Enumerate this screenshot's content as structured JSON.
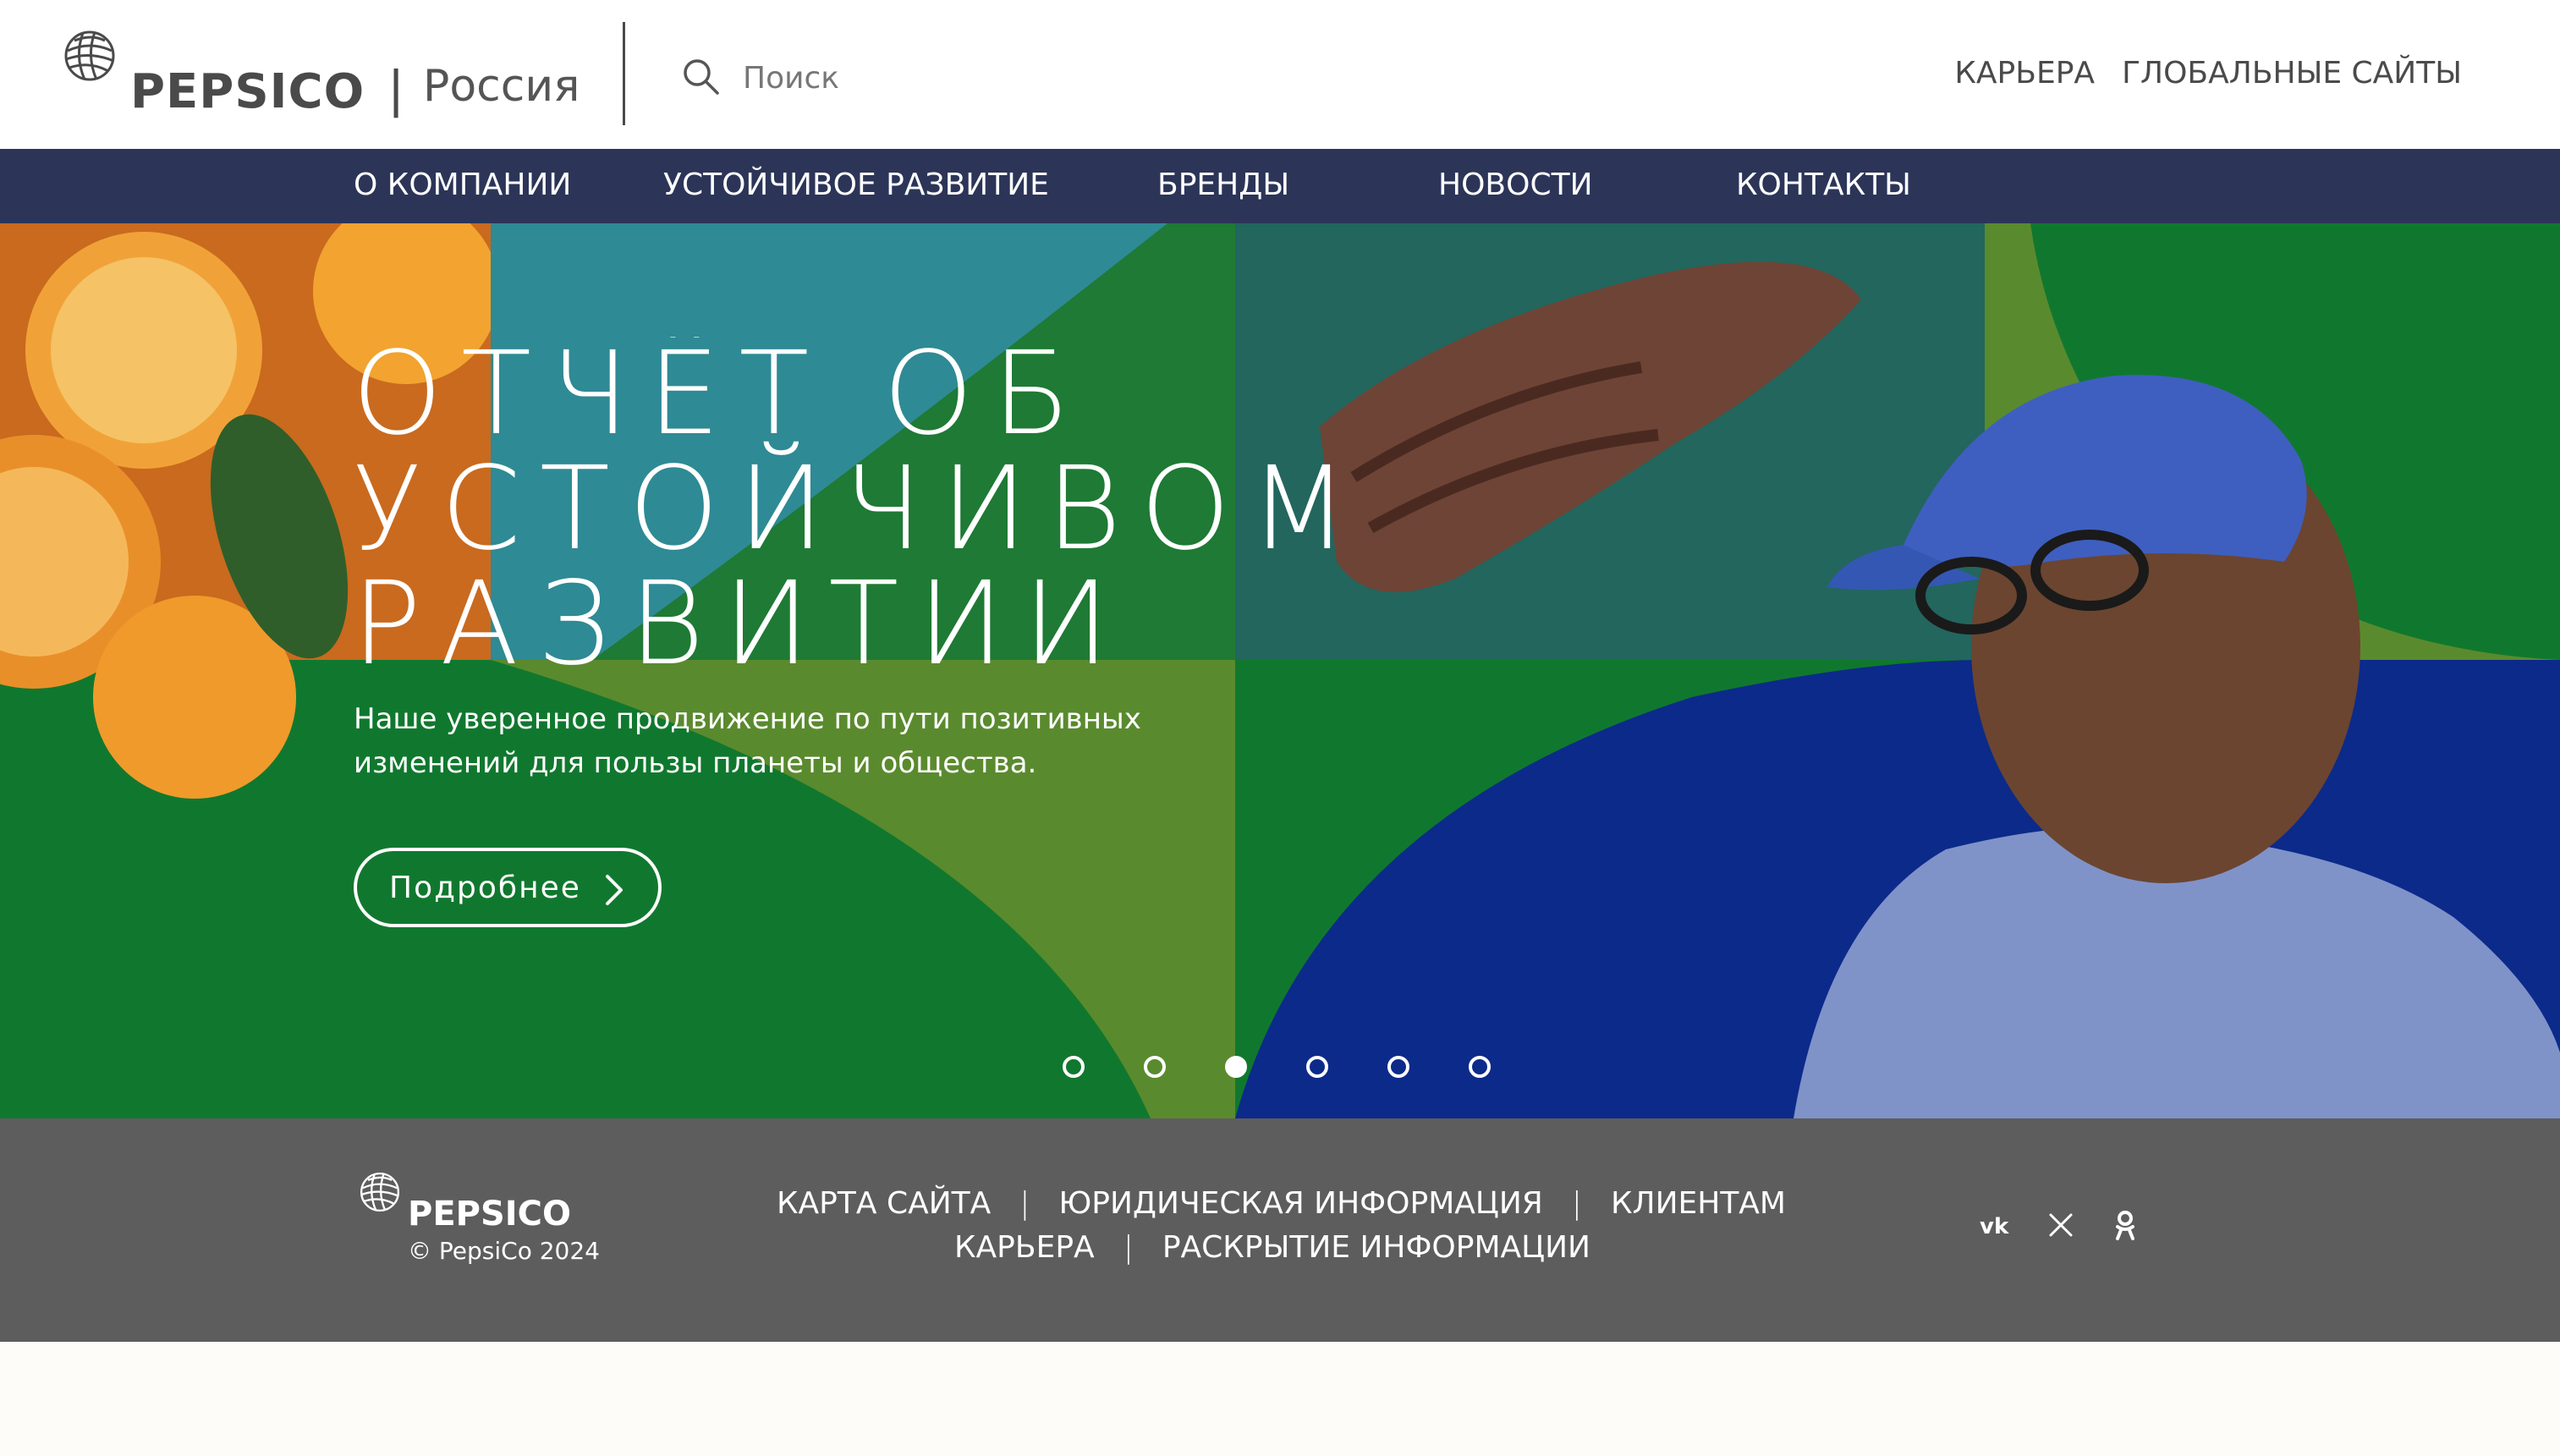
{
  "header": {
    "brand": "PEPSICO",
    "region_separator": "|",
    "region": "Россия",
    "search": {
      "placeholder": "Поиск",
      "icon": "search-icon"
    },
    "links": [
      "КАРЬЕРА",
      "ГЛОБАЛЬНЫЕ САЙТЫ"
    ]
  },
  "nav": {
    "items": [
      "О КОМПАНИИ",
      "УСТОЙЧИВОЕ РАЗВИТИЕ",
      "БРЕНДЫ",
      "НОВОСТИ",
      "КОНТАКТЫ"
    ]
  },
  "hero": {
    "title_lines": [
      "ОТЧЁТ ОБ",
      "УСТОЙЧИВОМ",
      "РАЗВИТИИ"
    ],
    "subtitle_lines": [
      "Наше уверенное продвижение по пути позитивных",
      "изменений для пользы планеты и общества."
    ],
    "cta_label": "Подробнее",
    "slides_total": 6,
    "slide_active": 3
  },
  "footer": {
    "brand": "PEPSICO",
    "copyright": "© PepsiCo 2024",
    "links_row1": [
      "КАРТА САЙТА",
      "ЮРИДИЧЕСКАЯ ИНФОРМАЦИЯ",
      "КЛИЕНТАМ"
    ],
    "links_row2": [
      "КАРЬЕРА",
      "РАСКРЫТИЕ ИНФОРМАЦИИ"
    ],
    "separator": "|",
    "social_icons": [
      "vk-icon",
      "x-twitter-icon",
      "odnoklassniki-icon"
    ]
  },
  "colors": {
    "nav_bg": "#2c3558",
    "hero_green": "#10782e",
    "hero_olive": "#5a8a2e",
    "hero_blue": "#0c2a8a",
    "hero_teal": "#2e8a94",
    "footer_bg": "#5d5d5d"
  }
}
